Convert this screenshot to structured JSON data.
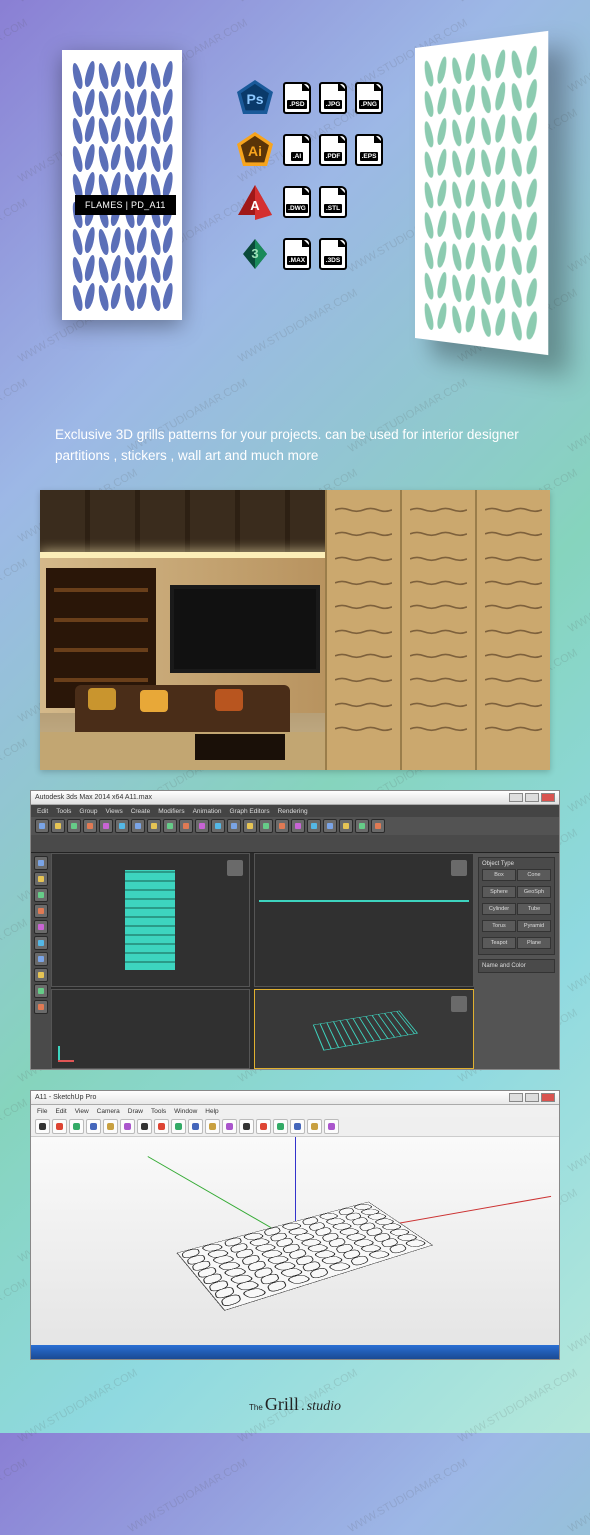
{
  "product": {
    "label": "FLAMES | PD_A11"
  },
  "description": "Exclusive  3D grills patterns for your projects.  can be used for interior designer partitions , stickers , wall art and much more",
  "watermark": "WWW.STUDIOAMAR.COM",
  "formats": {
    "photoshop": [
      ".PSD",
      ".JPG",
      ".PNG"
    ],
    "illustrator": [
      ".AI",
      ".PDF",
      ".EPS"
    ],
    "autocad": [
      ".DWG",
      ".STL"
    ],
    "max3ds": [
      ".MAX",
      ".3DS"
    ]
  },
  "apps": {
    "max_title": "Autodesk 3ds Max 2014 x64   A11.max",
    "max_menu": [
      "Edit",
      "Tools",
      "Group",
      "Views",
      "Create",
      "Modifiers",
      "Animation",
      "Graph Editors",
      "Rendering"
    ],
    "side_panel": {
      "h1": "Object Type",
      "btns": [
        "Box",
        "Cone",
        "Sphere",
        "GeoSph",
        "Cylinder",
        "Tube",
        "Torus",
        "Pyramid",
        "Teapot",
        "Plane"
      ],
      "h2": "Name and Color"
    },
    "sketchup_title": "A11 - SketchUp Pro",
    "su_menu": [
      "File",
      "Edit",
      "View",
      "Camera",
      "Draw",
      "Tools",
      "Window",
      "Help"
    ]
  },
  "footer": {
    "the": "The",
    "grill": "Grill",
    "dot": ".",
    "studio": "studio"
  }
}
